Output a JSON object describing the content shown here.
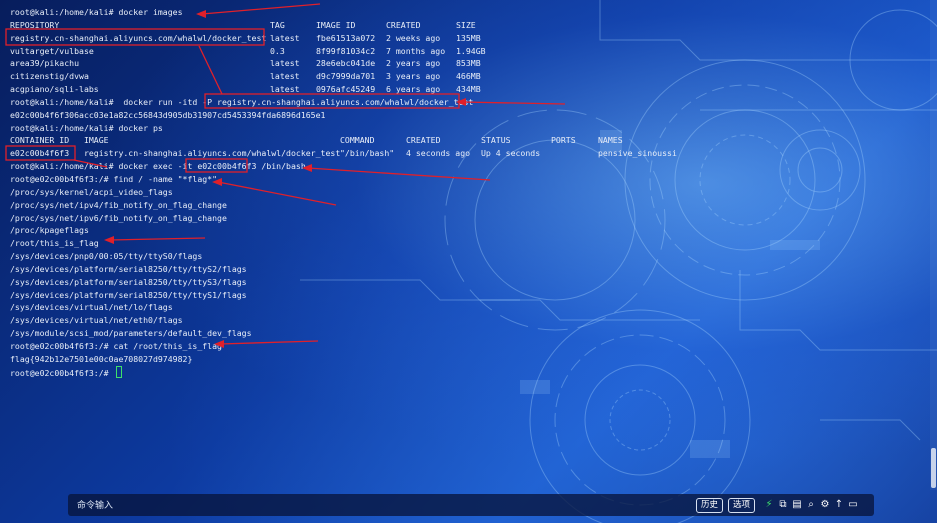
{
  "terminal": {
    "lines": [
      {
        "prompt": "root@kali:/home/kali#",
        "command": " docker images"
      },
      {
        "cols": [
          "REPOSITORY",
          "TAG",
          "IMAGE ID",
          "CREATED",
          "SIZE"
        ]
      },
      {
        "cols": [
          "registry.cn-shanghai.aliyuncs.com/whalwl/docker_test",
          "latest",
          "fbe61513a072",
          "2 weeks ago",
          "135MB"
        ]
      },
      {
        "cols": [
          "vultarget/vulbase",
          "0.3",
          "8f99f81034c2",
          "7 months ago",
          "1.94GB"
        ]
      },
      {
        "cols": [
          "area39/pikachu",
          "latest",
          "28e6ebc041de",
          "2 years ago",
          "853MB"
        ]
      },
      {
        "cols": [
          "citizenstig/dvwa",
          "latest",
          "d9c7999da701",
          "3 years ago",
          "466MB"
        ]
      },
      {
        "cols": [
          "acgpiano/sqli-labs",
          "latest",
          "0976afc45249",
          "6 years ago",
          "434MB"
        ]
      },
      {
        "prompt": "root@kali:/home/kali#",
        "command": "  docker run -itd -P registry.cn-shanghai.aliyuncs.com/whalwl/docker_test"
      },
      {
        "text": "e02c00b4f6f306acc03e1a82cc56843d905db31907cd5453394fda6896d165e1"
      },
      {
        "prompt": "root@kali:/home/kali#",
        "command": " docker ps"
      },
      {
        "cols": [
          "CONTAINER ID   IMAGE",
          "COMMAND",
          "CREATED",
          "STATUS",
          "PORTS",
          "NAMES"
        ]
      },
      {
        "cols": [
          "e02c00b4f6f3   registry.cn-shanghai.aliyuncs.com/whalwl/docker_test",
          "\"/bin/bash\"",
          "4 seconds ago",
          "Up 4 seconds",
          "",
          "pensive_sinoussi"
        ]
      },
      {
        "prompt": "root@kali:/home/kali#",
        "command": " docker exec -it e02c00b4f6f3 /bin/bash"
      },
      {
        "prompt": "root@e02c00b4f6f3:/#",
        "command": " find / -name \"*flag*\""
      },
      {
        "text": "/proc/sys/kernel/acpi_video_flags"
      },
      {
        "text": "/proc/sys/net/ipv4/fib_notify_on_flag_change"
      },
      {
        "text": "/proc/sys/net/ipv6/fib_notify_on_flag_change"
      },
      {
        "text": "/proc/kpageflags"
      },
      {
        "text": "/root/this_is_flag"
      },
      {
        "text": "/sys/devices/pnp0/00:05/tty/ttyS0/flags"
      },
      {
        "text": "/sys/devices/platform/serial8250/tty/ttyS2/flags"
      },
      {
        "text": "/sys/devices/platform/serial8250/tty/ttyS3/flags"
      },
      {
        "text": "/sys/devices/platform/serial8250/tty/ttyS1/flags"
      },
      {
        "text": "/sys/devices/virtual/net/lo/flags"
      },
      {
        "text": "/sys/devices/virtual/net/eth0/flags"
      },
      {
        "text": "/sys/module/scsi_mod/parameters/default_dev_flags"
      },
      {
        "prompt": "root@e02c00b4f6f3:/#",
        "command": " cat /root/this_is_flag"
      },
      {
        "text": "flag{942b12e7501e00c0ae708027d974982}"
      },
      {
        "prompt": "root@e02c00b4f6f3:/#",
        "command": " ",
        "cursor": true
      }
    ]
  },
  "cmdbar": {
    "placeholder": "命令输入",
    "history_label": "历史",
    "options_label": "选项",
    "icons": [
      "lightning-icon",
      "copy-icon",
      "paste-icon",
      "search-icon",
      "gear-icon",
      "arrow-up-icon",
      "window-icon"
    ]
  },
  "colors": {
    "annotation": "#e0202a",
    "cursor": "#3ee06a",
    "text": "#e8eef8"
  }
}
